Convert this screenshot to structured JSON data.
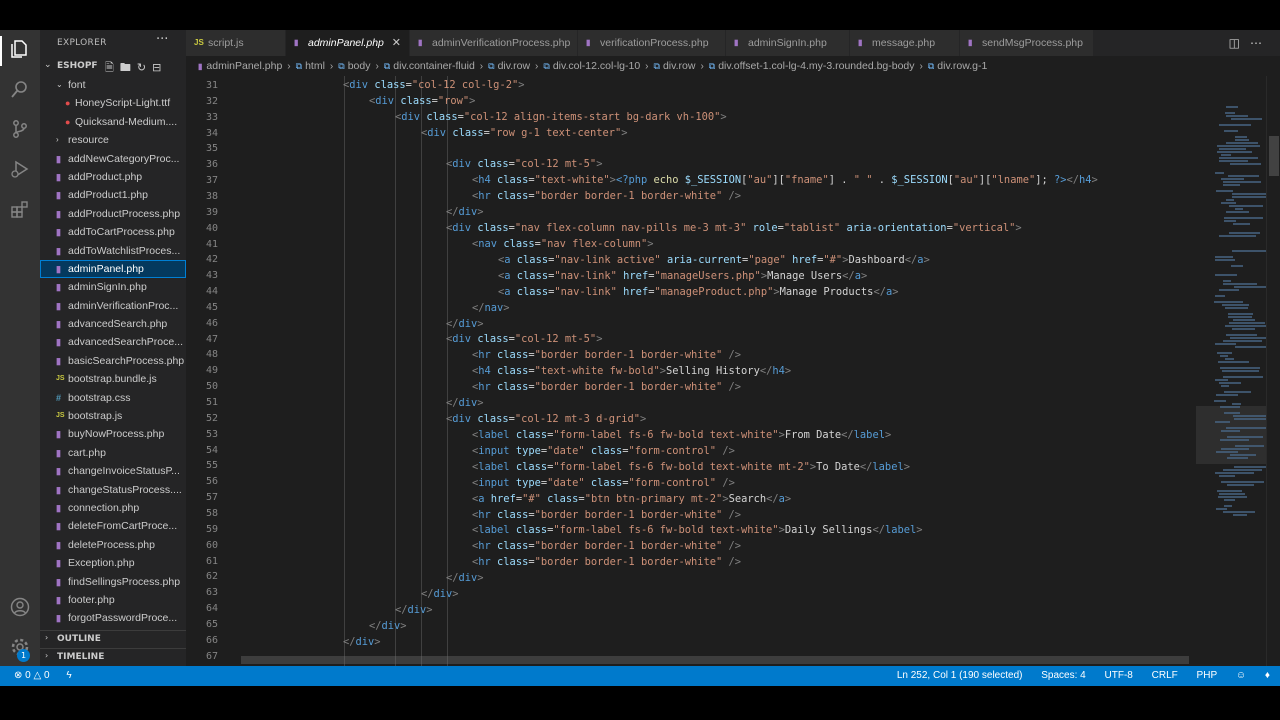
{
  "sidebar": {
    "title": "EXPLORER",
    "more": "···",
    "root": "ESHOPF",
    "folders": {
      "font": "font",
      "resource": "resource"
    },
    "font_files": [
      "HoneyScript-Light.ttf",
      "Quicksand-Medium...."
    ],
    "files": [
      {
        "name": "addNewCategoryProc...",
        "type": "php"
      },
      {
        "name": "addProduct.php",
        "type": "php"
      },
      {
        "name": "addProduct1.php",
        "type": "php"
      },
      {
        "name": "addProductProcess.php",
        "type": "php"
      },
      {
        "name": "addToCartProcess.php",
        "type": "php"
      },
      {
        "name": "addToWatchlistProces...",
        "type": "php"
      },
      {
        "name": "adminPanel.php",
        "type": "php"
      },
      {
        "name": "adminSignIn.php",
        "type": "php"
      },
      {
        "name": "adminVerificationProc...",
        "type": "php"
      },
      {
        "name": "advancedSearch.php",
        "type": "php"
      },
      {
        "name": "advancedSearchProce...",
        "type": "php"
      },
      {
        "name": "basicSearchProcess.php",
        "type": "php"
      },
      {
        "name": "bootstrap.bundle.js",
        "type": "js"
      },
      {
        "name": "bootstrap.css",
        "type": "css"
      },
      {
        "name": "bootstrap.js",
        "type": "js"
      },
      {
        "name": "buyNowProcess.php",
        "type": "php"
      },
      {
        "name": "cart.php",
        "type": "php"
      },
      {
        "name": "changeInvoiceStatusP...",
        "type": "php"
      },
      {
        "name": "changeStatusProcess....",
        "type": "php"
      },
      {
        "name": "connection.php",
        "type": "php"
      },
      {
        "name": "deleteFromCartProce...",
        "type": "php"
      },
      {
        "name": "deleteProcess.php",
        "type": "php"
      },
      {
        "name": "Exception.php",
        "type": "php"
      },
      {
        "name": "findSellingsProcess.php",
        "type": "php"
      },
      {
        "name": "footer.php",
        "type": "php"
      },
      {
        "name": "forgotPasswordProce...",
        "type": "php"
      }
    ],
    "selected_file": "adminPanel.php",
    "outline": "OUTLINE",
    "timeline": "TIMELINE"
  },
  "tabs": [
    {
      "label": "script.js",
      "type": "js",
      "active": false
    },
    {
      "label": "adminPanel.php",
      "type": "php",
      "active": true
    },
    {
      "label": "adminVerificationProcess.php",
      "type": "php",
      "active": false
    },
    {
      "label": "verificationProcess.php",
      "type": "php",
      "active": false
    },
    {
      "label": "adminSignIn.php",
      "type": "php",
      "active": false
    },
    {
      "label": "message.php",
      "type": "php",
      "active": false
    },
    {
      "label": "sendMsgProcess.php",
      "type": "php",
      "active": false
    }
  ],
  "breadcrumb": [
    "adminPanel.php",
    "html",
    "body",
    "div.container-fluid",
    "div.row",
    "div.col-12.col-lg-10",
    "div.row",
    "div.offset-1.col-lg-4.my-3.rounded.bg-body",
    "div.row.g-1"
  ],
  "editor": {
    "line_numbers": [
      "31",
      "32",
      "33",
      "34",
      "35",
      "36",
      "37",
      "38",
      "39",
      "40",
      "41",
      "42",
      "43",
      "44",
      "45",
      "46",
      "47",
      "48",
      "49",
      "50",
      "51",
      "52",
      "53",
      "54",
      "55",
      "56",
      "57",
      "58",
      "59",
      "60",
      "61",
      "62",
      "63",
      "64",
      "65",
      "66",
      "67"
    ]
  },
  "statusbar": {
    "errors": "0",
    "warnings": "0",
    "position": "Ln 252, Col 1 (190 selected)",
    "spaces": "Spaces: 4",
    "encoding": "UTF-8",
    "eol": "CRLF",
    "language": "PHP"
  },
  "colors": {
    "statusbar": "#007acc",
    "editor_bg": "#1e1e1e",
    "sidebar_bg": "#252526",
    "activity_bg": "#333333",
    "tag": "#569cd6",
    "attr": "#9cdcfe",
    "string": "#ce9178"
  },
  "icons": [
    "explorer-icon",
    "search-icon",
    "source-control-icon",
    "run-debug-icon",
    "extensions-icon",
    "account-icon",
    "settings-gear-icon"
  ]
}
